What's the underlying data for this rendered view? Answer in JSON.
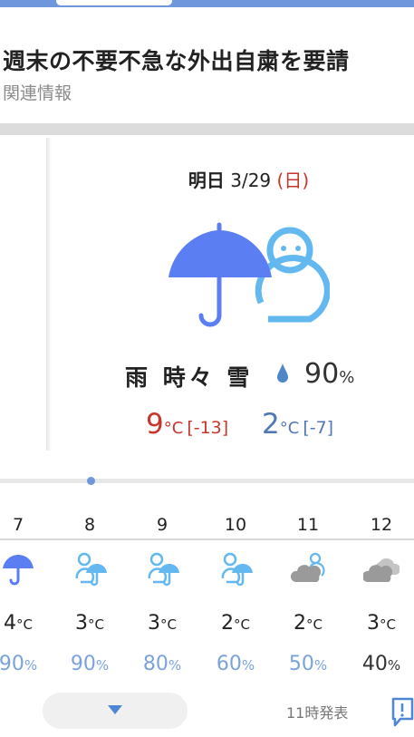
{
  "article": {
    "headline": "週末の不要不急な外出自粛を要請",
    "related": "関連情報"
  },
  "forecast": {
    "day_prefix": "明日",
    "date": "3/29",
    "weekday": "(日)",
    "main_icon": "umbrella-snowman-icon",
    "condition": "雨 時々 雪",
    "precip_value": "90",
    "precip_unit": "%",
    "high_temp": "9",
    "high_diff": "[-13]",
    "low_temp": "2",
    "low_diff": "[-7]",
    "temp_unit": "°C"
  },
  "hourly": [
    {
      "hour": "7",
      "icon": "umbrella-icon",
      "temp": "4",
      "precip": "90"
    },
    {
      "hour": "8",
      "icon": "snowman-umbrella-icon",
      "temp": "3",
      "precip": "90"
    },
    {
      "hour": "9",
      "icon": "snowman-umbrella-icon",
      "temp": "3",
      "precip": "80"
    },
    {
      "hour": "10",
      "icon": "snowman-umbrella-icon",
      "temp": "2",
      "precip": "60"
    },
    {
      "hour": "11",
      "icon": "cloud-snowman-icon",
      "temp": "2",
      "precip": "50"
    },
    {
      "hour": "12",
      "icon": "cloudy-icon",
      "temp": "3",
      "precip": "40"
    }
  ],
  "hourly_units": {
    "temp": "°C",
    "precip": "%"
  },
  "footer": {
    "issued": "11時発表",
    "expand_icon": "chevron-down-icon",
    "feedback_icon": "feedback-icon"
  },
  "colors": {
    "accent": "#6f98dc",
    "rain_icon": "#5b7ef2",
    "snow_icon": "#63b8f0",
    "high": "#c8352d",
    "low": "#4f78b8",
    "precip": "#7aa3dd",
    "cloud": "#9a9a9a"
  }
}
